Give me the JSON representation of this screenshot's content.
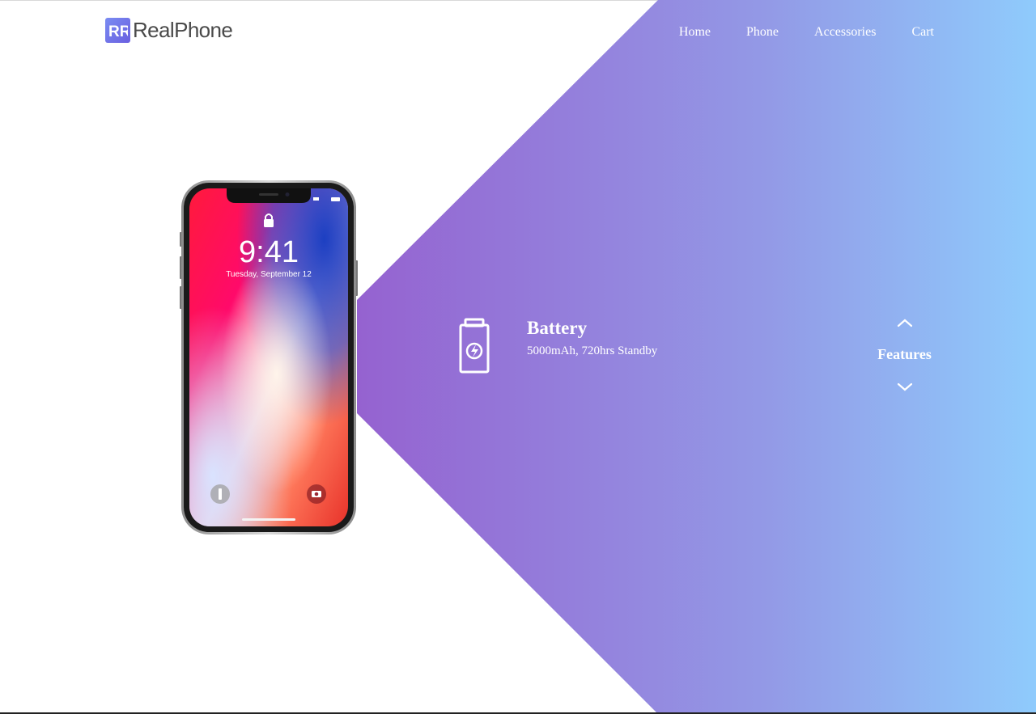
{
  "brand": {
    "name": "RealPhone",
    "logo_letters": "RR"
  },
  "nav": {
    "items": [
      "Home",
      "Phone",
      "Accessories",
      "Cart"
    ]
  },
  "phone_screen": {
    "time": "9:41",
    "date": "Tuesday, September 12"
  },
  "feature": {
    "title": "Battery",
    "description": "5000mAh, 720hrs Standby",
    "icon": "battery-charging-icon"
  },
  "side_nav": {
    "label": "Features",
    "up_icon": "chevron-up-icon",
    "down_icon": "chevron-down-icon"
  },
  "colors": {
    "gradient_start": "#9562d0",
    "gradient_end": "#8fcbfc",
    "logo_text": "#4a4a4a"
  }
}
